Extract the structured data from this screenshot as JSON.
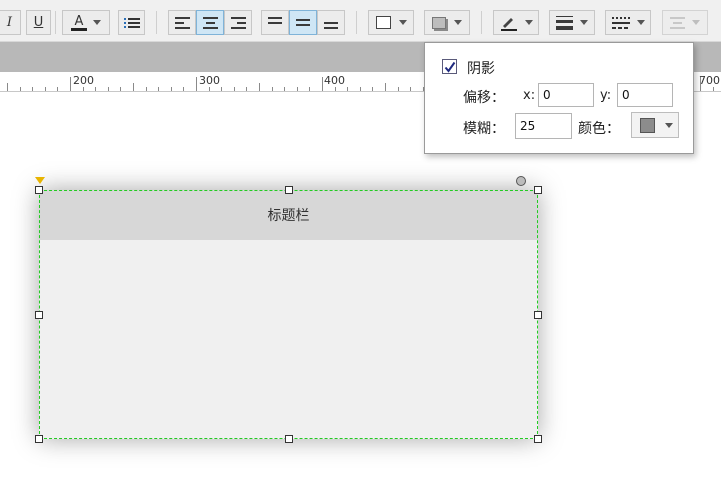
{
  "toolbar": {
    "italic_label": "I",
    "underline_label": "U",
    "font_color_label": "A",
    "icons": [
      "italic-icon",
      "underline-icon",
      "font-color-icon",
      "bullet-list-icon",
      "align-left-icon",
      "align-center-icon",
      "align-right-icon",
      "valign-top-icon",
      "valign-middle-icon",
      "valign-bottom-icon",
      "fill-color-icon",
      "shadow-icon",
      "line-color-icon",
      "line-width-icon",
      "line-style-icon",
      "arrow-style-icon"
    ]
  },
  "ruler": {
    "labels": [
      "200",
      "300",
      "400",
      "700"
    ]
  },
  "shadow_popup": {
    "enabled_label": "阴影",
    "enabled": true,
    "offset_label": "偏移：",
    "x_label": "x:",
    "x_value": "0",
    "y_label": "y:",
    "y_value": "0",
    "blur_label": "模糊：",
    "blur_value": "25",
    "color_label": "颜色：",
    "color_value": "#8c8c8c"
  },
  "canvas": {
    "widget_title": "标题栏"
  },
  "colors": {
    "selection_border": "#22cc22",
    "active_button": "#cfe6f5",
    "title_bar": "#d7d7d7",
    "panel_body": "#f0f0f0"
  }
}
